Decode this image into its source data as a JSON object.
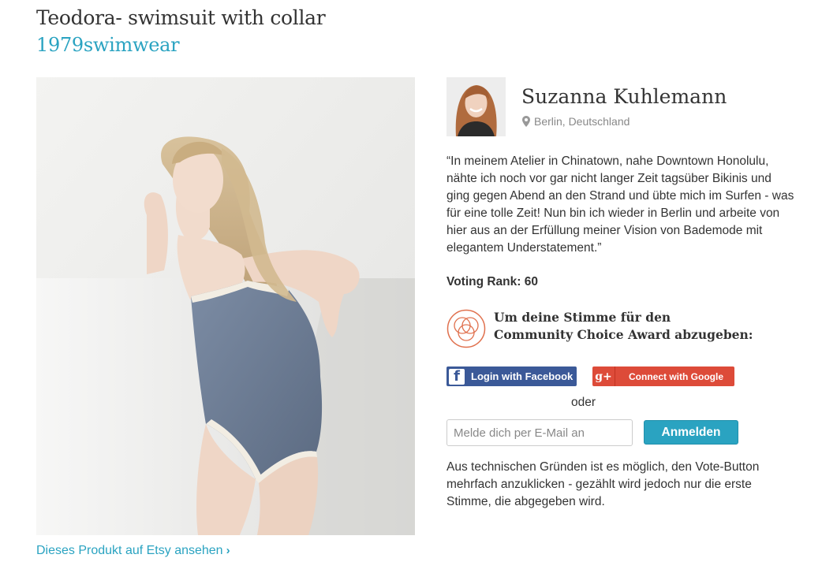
{
  "product": {
    "title": "Teodora- swimsuit with collar",
    "brand": "1979swimwear",
    "etsy_link": "Dieses Produkt auf Etsy ansehen",
    "etsy_chevron": "›"
  },
  "designer": {
    "name": "Suzanna Kuhlemann",
    "location": "Berlin, Deutschland",
    "quote": "“In meinem Atelier in Chinatown, nahe Downtown Honolulu, nähte ich noch vor gar nicht langer Zeit tagsüber Bikinis und ging gegen Abend an den Strand und übte mich im Surfen - was für eine tolle Zeit! Nun bin ich wieder in Berlin und arbeite von hier aus an der Erfüllung meiner Vision von Bademode mit elegantem Understatement.”"
  },
  "voting": {
    "rank_label": "Voting Rank:",
    "rank_value": "60",
    "prompt_line1": "Um deine Stimme für den",
    "prompt_line2": "Community Choice Award abzugeben:",
    "facebook_label": "Login with Facebook",
    "google_label": "Connect with Google",
    "google_icon_text": "g+",
    "facebook_icon_text": "f",
    "or_text": "oder",
    "email_placeholder": "Melde dich per E-Mail an",
    "submit_label": "Anmelden",
    "disclaimer": "Aus technischen Gründen ist es möglich, den Vote-Button mehrfach anzuklicken - gezählt wird jedoch nur die erste Stimme, die abgegeben wird."
  },
  "icons": {
    "location": "map-pin-icon",
    "award": "award-logo-icon",
    "chevron": "chevron-right-icon"
  },
  "colors": {
    "accent": "#2aa3c1",
    "facebook": "#3b5998",
    "google": "#dd4b39",
    "award": "#e0704d",
    "swimsuit": "#6e7f97"
  }
}
